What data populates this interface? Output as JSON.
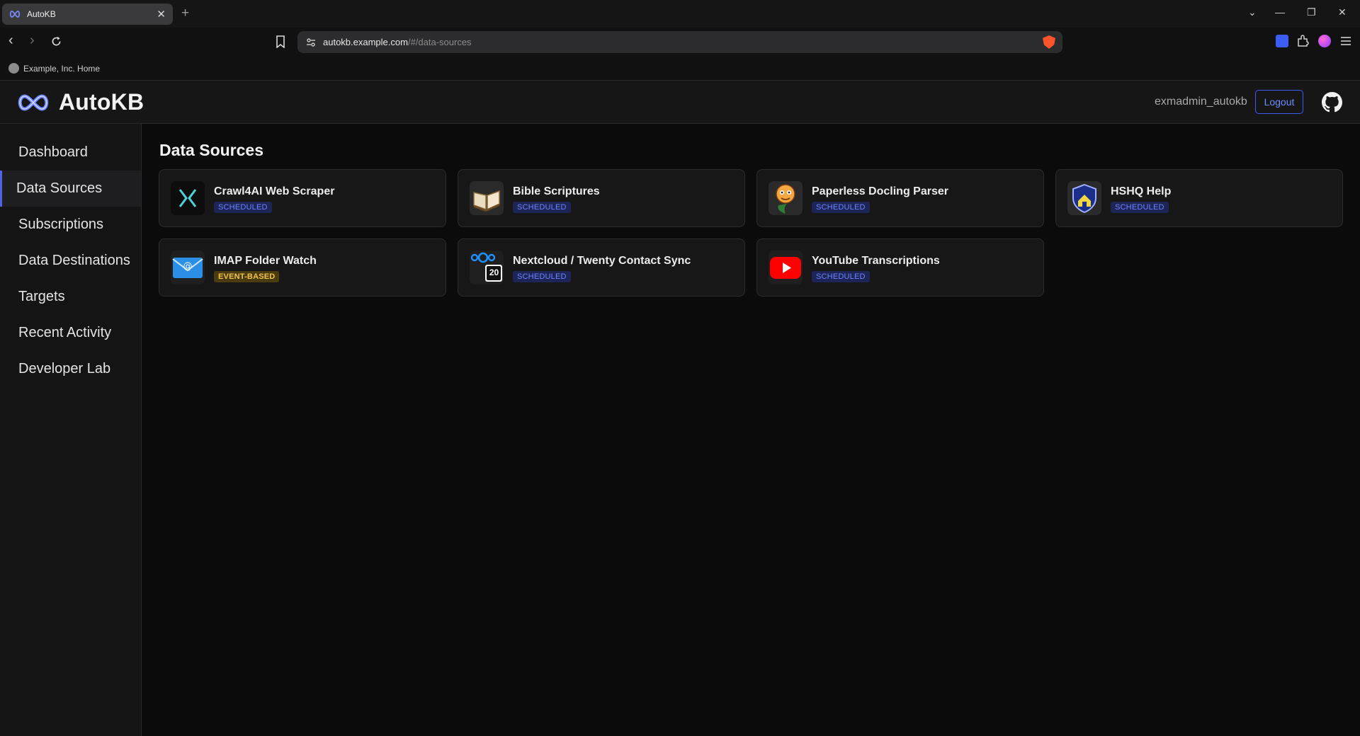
{
  "browser": {
    "tab_title": "AutoKB",
    "new_tab": "+",
    "url_host": "autokb.example.com",
    "url_path": "/#/data-sources",
    "bookmark": "Example, Inc. Home"
  },
  "header": {
    "app_name": "AutoKB",
    "username": "exmadmin_autokb",
    "logout_label": "Logout"
  },
  "sidebar": {
    "items": [
      {
        "label": "Dashboard"
      },
      {
        "label": "Data Sources"
      },
      {
        "label": "Subscriptions"
      },
      {
        "label": "Data Destinations"
      },
      {
        "label": "Targets"
      },
      {
        "label": "Recent Activity"
      },
      {
        "label": "Developer Lab"
      }
    ],
    "active": "Data Sources"
  },
  "main": {
    "title": "Data Sources",
    "cards": [
      {
        "name": "Crawl4AI Web Scraper",
        "badge": "SCHEDULED",
        "icon": "crawl4ai-icon"
      },
      {
        "name": "Bible Scriptures",
        "badge": "SCHEDULED",
        "icon": "book-icon"
      },
      {
        "name": "Paperless Docling Parser",
        "badge": "SCHEDULED",
        "icon": "docling-icon"
      },
      {
        "name": "HSHQ Help",
        "badge": "SCHEDULED",
        "icon": "shield-icon"
      },
      {
        "name": "IMAP Folder Watch",
        "badge": "EVENT-BASED",
        "icon": "envelope-icon"
      },
      {
        "name": "Nextcloud / Twenty Contact Sync",
        "badge": "SCHEDULED",
        "icon": "nextcloud-icon",
        "icon_text": "20"
      },
      {
        "name": "YouTube Transcriptions",
        "badge": "SCHEDULED",
        "icon": "youtube-icon"
      }
    ]
  },
  "colors": {
    "accent": "#4f63e8",
    "scheduled_badge": "#6f84ff",
    "event_badge": "#f1c24a"
  }
}
